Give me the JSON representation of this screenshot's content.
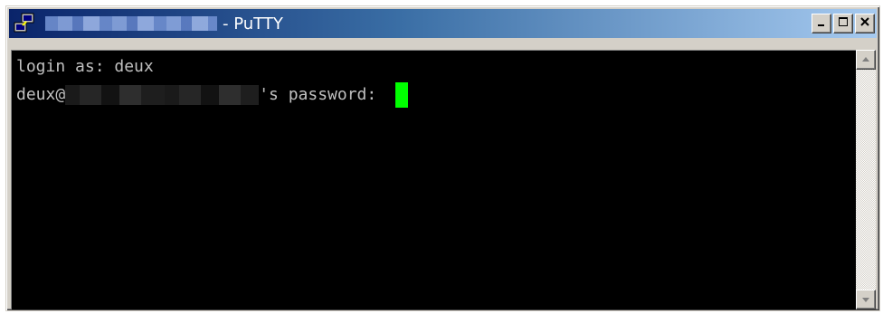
{
  "window": {
    "title": "- PuTTY",
    "title_buttons": [
      "minimize",
      "maximize",
      "close"
    ]
  },
  "terminal": {
    "line1": "login as: deux",
    "line2_prefix": "deux@",
    "line2_suffix": "'s password: "
  },
  "icons": {
    "app": "putty-icon",
    "minimize": "minimize-icon",
    "maximize": "maximize-icon",
    "close": "close-icon",
    "scroll_up": "arrow-up-icon",
    "scroll_down": "arrow-down-icon"
  },
  "colors": {
    "terminal_bg": "#000000",
    "terminal_fg": "#c0c0c0",
    "cursor": "#00ff00",
    "titlebar_start": "#0a246a",
    "titlebar_end": "#a6caf0"
  }
}
